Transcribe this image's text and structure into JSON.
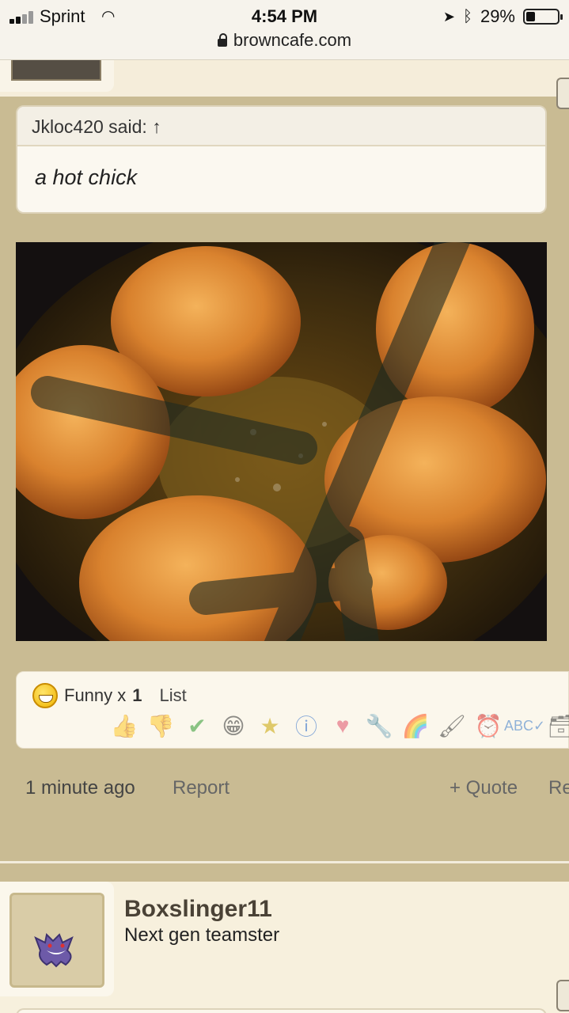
{
  "status": {
    "carrier": "Sprint",
    "time": "4:54 PM",
    "battery_pct": "29%",
    "battery_level": 0.29,
    "icons": [
      "signal-icon",
      "wifi-icon",
      "location-icon",
      "bluetooth-icon",
      "battery-icon"
    ]
  },
  "browser": {
    "url": "browncafe.com"
  },
  "quote": {
    "author_said": "Jkloc420 said: ↑",
    "text": "a hot chick"
  },
  "image": {
    "subject": "fried-chicken-in-pan",
    "overlay_mark": "large-dark-x-overlay"
  },
  "reactions": {
    "summary_label": "Funny x",
    "summary_count": "1",
    "list_label": "List",
    "icons": [
      "thumbs-up-icon",
      "thumbs-down-icon",
      "check-icon",
      "smile-icon",
      "star-medal-icon",
      "info-icon",
      "heart-icon",
      "wrench-icon",
      "rainbow-icon",
      "paintbrush-icon",
      "alarm-clock-icon",
      "spellcheck-icon",
      "box-icon"
    ]
  },
  "post_meta": {
    "time_ago": "1 minute ago",
    "report": "Report",
    "quote": "+ Quote",
    "reply": "Re"
  },
  "next_post": {
    "username": "Boxslinger11",
    "user_title": "Next gen teamster"
  },
  "colors": {
    "page_bg": "#c9bb93",
    "card_bg": "#fbf7ec",
    "accent": "#4a4236"
  }
}
